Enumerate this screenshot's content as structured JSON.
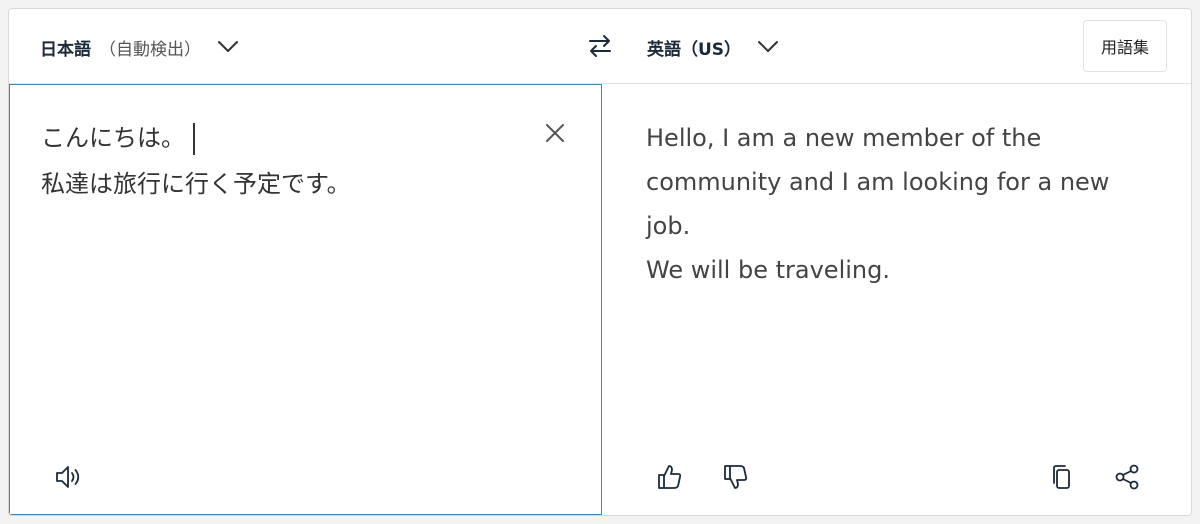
{
  "header": {
    "source_language": "日本語",
    "source_language_note": "（自動検出）",
    "target_language": "英語（US）",
    "glossary_label": "用語集"
  },
  "source": {
    "lines": [
      "こんにちは。",
      "私達は旅行に行く予定です。"
    ]
  },
  "target": {
    "lines": [
      "Hello, I am a new member of the",
      "community and I am looking for a new",
      "job.",
      "We will be traveling."
    ]
  },
  "icons": {
    "chevron": "chevron-down-icon",
    "swap": "swap-arrows-icon",
    "clear": "close-icon",
    "speaker": "speaker-icon",
    "thumbs_up": "thumbs-up-icon",
    "thumbs_down": "thumbs-down-icon",
    "copy": "copy-icon",
    "share": "share-icon"
  },
  "colors": {
    "accent_border": "#3d88b8",
    "language_name": "#1b2a3a"
  }
}
